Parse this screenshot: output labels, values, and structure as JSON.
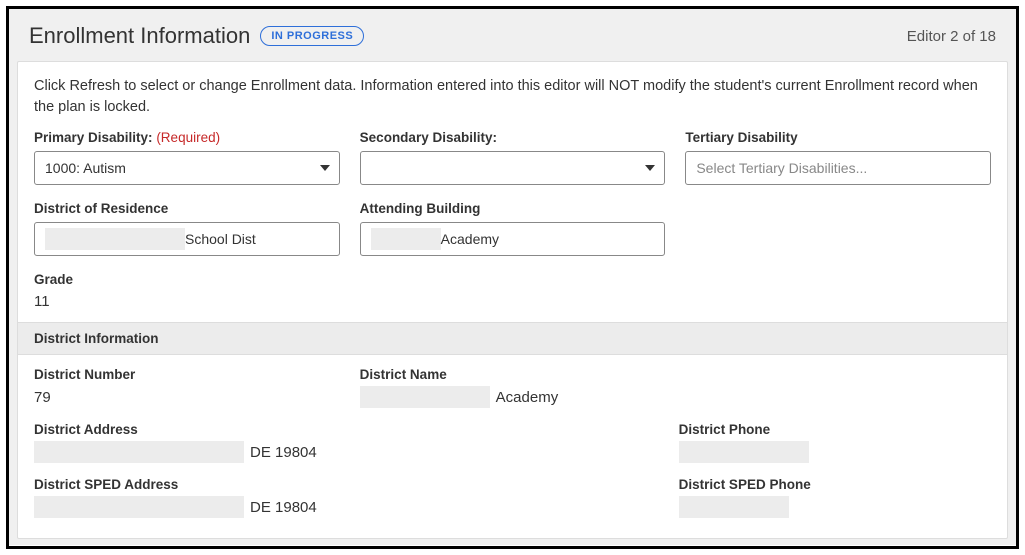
{
  "header": {
    "title": "Enrollment Information",
    "status": "IN PROGRESS",
    "editor_counter": "Editor 2 of 18"
  },
  "help_text": "Click Refresh to select or change Enrollment data. Information entered into this editor will NOT modify the student's current Enrollment record when the plan is locked.",
  "fields": {
    "primary_disability": {
      "label": "Primary Disability:",
      "required": "(Required)",
      "value": "1000: Autism"
    },
    "secondary_disability": {
      "label": "Secondary Disability:",
      "value": ""
    },
    "tertiary_disability": {
      "label": "Tertiary Disability",
      "placeholder": "Select Tertiary Disabilities..."
    },
    "district_of_residence": {
      "label": "District of Residence",
      "value_suffix": "School Dist"
    },
    "attending_building": {
      "label": "Attending Building",
      "value_suffix": "Academy"
    },
    "grade": {
      "label": "Grade",
      "value": "11"
    }
  },
  "district_section": {
    "title": "District Information",
    "number": {
      "label": "District Number",
      "value": "79"
    },
    "name": {
      "label": "District Name",
      "value_suffix": "Academy"
    },
    "address": {
      "label": "District Address",
      "value_suffix": "DE 19804"
    },
    "phone": {
      "label": "District Phone"
    },
    "sped_address": {
      "label": "District SPED Address",
      "value_suffix": "DE 19804"
    },
    "sped_phone": {
      "label": "District SPED Phone"
    }
  }
}
